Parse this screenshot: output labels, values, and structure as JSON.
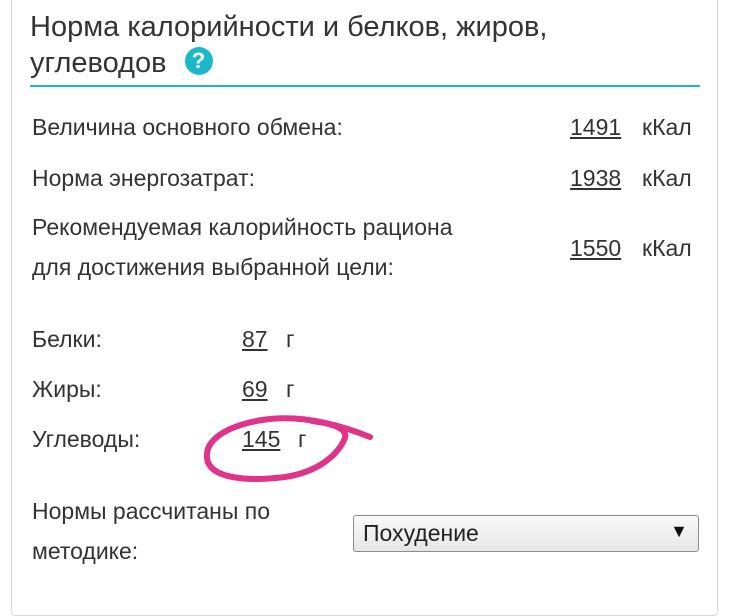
{
  "header": {
    "title_line1": "Норма калорийности и белков, жиров,",
    "title_line2": "углеводов",
    "help_icon": "question-circle-icon",
    "accent_color": "#1cb8c7"
  },
  "energy": {
    "bmr": {
      "label": "Величина основного обмена:",
      "value": "1491",
      "unit": "кКал"
    },
    "expenditure": {
      "label": "Норма энергозатрат:",
      "value": "1938",
      "unit": "кКал"
    },
    "recommended": {
      "label_line1": "Рекомендуемая калорийность рациона",
      "label_line2": "для достижения выбранной цели:",
      "value": "1550",
      "unit": "кКал"
    }
  },
  "macros": {
    "protein": {
      "label": "Белки:",
      "value": "87",
      "unit": "г"
    },
    "fat": {
      "label": "Жиры:",
      "value": "69",
      "unit": "г"
    },
    "carbs": {
      "label": "Углеводы:",
      "value": "145",
      "unit": "г"
    }
  },
  "method": {
    "label_line1": "Нормы рассчитаны по",
    "label_line2": "методике:",
    "selected": "Похудение"
  },
  "annotation": {
    "color": "#e0338a"
  }
}
